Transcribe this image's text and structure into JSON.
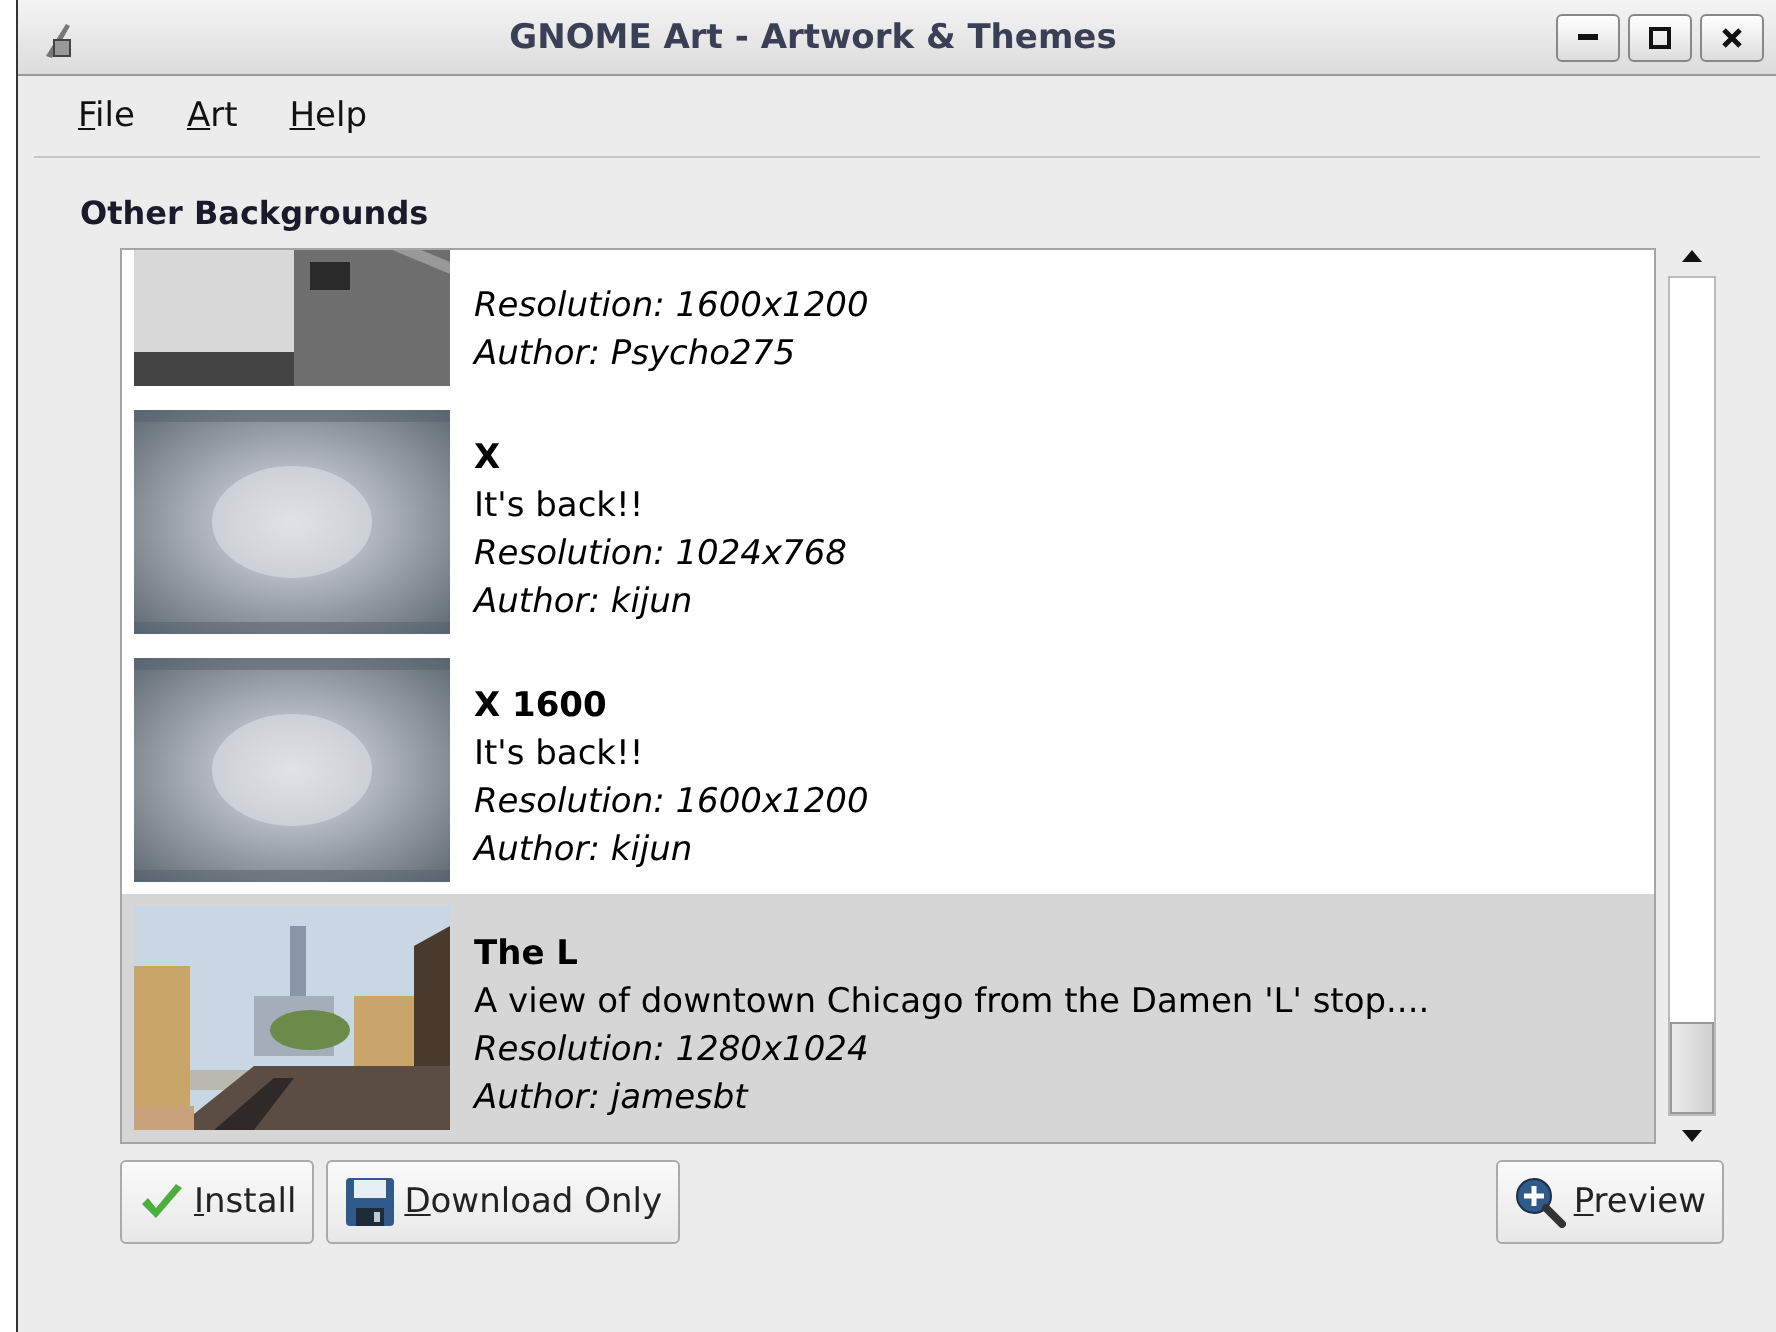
{
  "window": {
    "title": "GNOME Art - Artwork & Themes"
  },
  "menu": [
    {
      "label": "File"
    },
    {
      "label": "Art"
    },
    {
      "label": "Help"
    }
  ],
  "section_title": "Other Backgrounds",
  "items": [
    {
      "resolution": "Resolution: 1600x1200",
      "author": "Author: Psycho275",
      "selected": false
    },
    {
      "title": "X",
      "description": "It's back!!",
      "resolution": "Resolution: 1024x768",
      "author": "Author: kijun",
      "selected": false
    },
    {
      "title": "X 1600",
      "description": "It's back!!",
      "resolution": "Resolution: 1600x1200",
      "author": "Author: kijun",
      "selected": false
    },
    {
      "title": "The L",
      "description": "A view of downtown Chicago from the Damen 'L' stop....",
      "resolution": "Resolution: 1280x1024",
      "author": "Author: jamesbt",
      "selected": true
    }
  ],
  "buttons": [
    {
      "label": "Install",
      "kind": "install"
    },
    {
      "label": "Download Only",
      "kind": "download"
    },
    {
      "label": "Preview",
      "kind": "preview"
    }
  ]
}
